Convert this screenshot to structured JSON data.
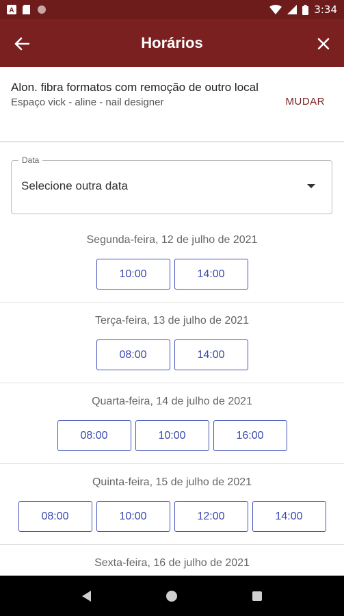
{
  "colors": {
    "status_bar": "#6e1b1b",
    "app_bar": "#7a2020",
    "accent": "#7a2020",
    "slot_border": "#3f51b5",
    "slot_text": "#3949ab"
  },
  "status_bar": {
    "time": "3:34",
    "left_icons": [
      "a-notification-icon",
      "sd-card-icon",
      "circle-notification-icon"
    ],
    "right_icons": [
      "wifi-icon",
      "cell-signal-icon",
      "battery-icon"
    ]
  },
  "app_bar": {
    "title": "Horários",
    "back_icon": "arrow-left-icon",
    "close_icon": "close-icon"
  },
  "service": {
    "name": "Alon. fibra formatos com remoção de outro local",
    "place": "Espaço vick - aline - nail designer",
    "change_label": "MUDAR"
  },
  "date_select": {
    "label": "Data",
    "value": "Selecione outra data"
  },
  "days": [
    {
      "title": "Segunda-feira, 12 de julho de 2021",
      "slots": [
        "10:00",
        "14:00"
      ]
    },
    {
      "title": "Terça-feira, 13 de julho de 2021",
      "slots": [
        "08:00",
        "14:00"
      ]
    },
    {
      "title": "Quarta-feira, 14 de julho de 2021",
      "slots": [
        "08:00",
        "10:00",
        "16:00"
      ]
    },
    {
      "title": "Quinta-feira, 15 de julho de 2021",
      "slots": [
        "08:00",
        "10:00",
        "12:00",
        "14:00"
      ]
    },
    {
      "title": "Sexta-feira, 16 de julho de 2021",
      "slots": []
    }
  ]
}
